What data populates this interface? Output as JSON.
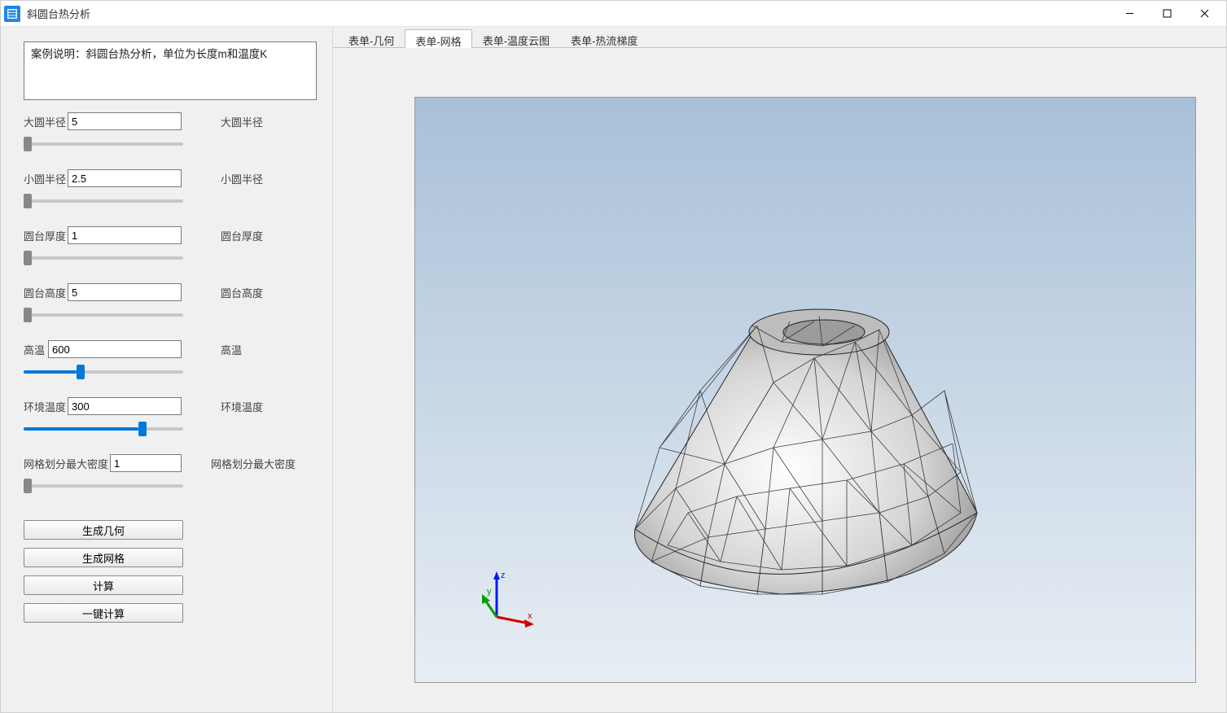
{
  "app": {
    "title": "斜圆台热分析"
  },
  "case_description": "案例说明：斜圆台热分析，单位为长度m和温度K",
  "params": {
    "big_radius": {
      "label": "大圆半径",
      "value": "5",
      "right": "大圆半径",
      "fill_pct": 0
    },
    "small_radius": {
      "label": "小圆半径",
      "value": "2.5",
      "right": "小圆半径",
      "fill_pct": 0
    },
    "thickness": {
      "label": "圆台厚度",
      "value": "1",
      "right": "圆台厚度",
      "fill_pct": 0
    },
    "height": {
      "label": "圆台高度",
      "value": "5",
      "right": "圆台高度",
      "fill_pct": 0
    },
    "high_temp": {
      "label": "高温",
      "value": "600",
      "right": "高温",
      "fill_pct": 33
    },
    "env_temp": {
      "label": "环境温度",
      "value": "300",
      "right": "环境温度",
      "fill_pct": 72
    },
    "mesh_density": {
      "label": "网格划分最大密度",
      "value": "1",
      "right": "网格划分最大密度",
      "fill_pct": 0
    }
  },
  "buttons": {
    "gen_geometry": "生成几何",
    "gen_mesh": "生成网格",
    "compute": "计算",
    "one_key": "一键计算"
  },
  "tabs": [
    {
      "id": "geom",
      "label": "表单-几何"
    },
    {
      "id": "mesh",
      "label": "表单-网格",
      "active": true
    },
    {
      "id": "temp",
      "label": "表单-温度云图"
    },
    {
      "id": "flux",
      "label": "表单-热流梯度"
    }
  ],
  "toolbar3d": {
    "camera": "camera-icon",
    "cube": "cube-icon",
    "fit": "fit-extents-icon",
    "axes": "axes-icon",
    "rotcw": "rotate-cw-icon",
    "rotccw": "rotate-ccw-icon"
  },
  "axes": {
    "x": "x",
    "y": "y",
    "z": "z"
  }
}
